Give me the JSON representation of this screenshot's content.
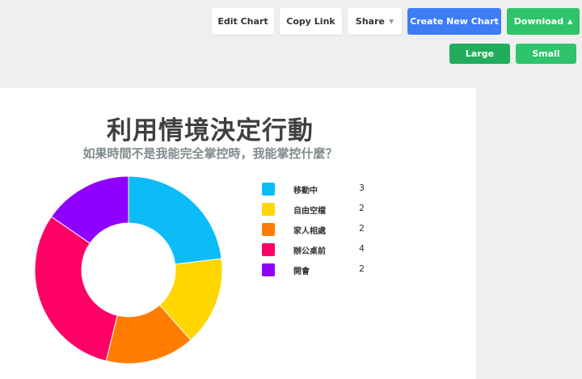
{
  "toolbar": {
    "edit_chart": "Edit Chart",
    "copy_link": "Copy Link",
    "share": "Share",
    "create_new_chart": "Create New Chart",
    "download": "Download",
    "large": "Large",
    "small": "Small"
  },
  "colors": {
    "blue_button": "#3d7cf3",
    "green_button": "#2fc36b"
  },
  "chart_data": {
    "type": "pie",
    "title": "利用情境決定行動",
    "subtitle": "如果時間不是我能完全掌控時，我能掌控什麼？",
    "categories": [
      "移動中",
      "自由空檔",
      "家人相處",
      "辦公桌前",
      "開會"
    ],
    "values": [
      3,
      2,
      2,
      4,
      2
    ],
    "colors": [
      "#0bbcf8",
      "#ffd600",
      "#ff7c00",
      "#ff0066",
      "#8f00ff"
    ],
    "donut": true
  }
}
